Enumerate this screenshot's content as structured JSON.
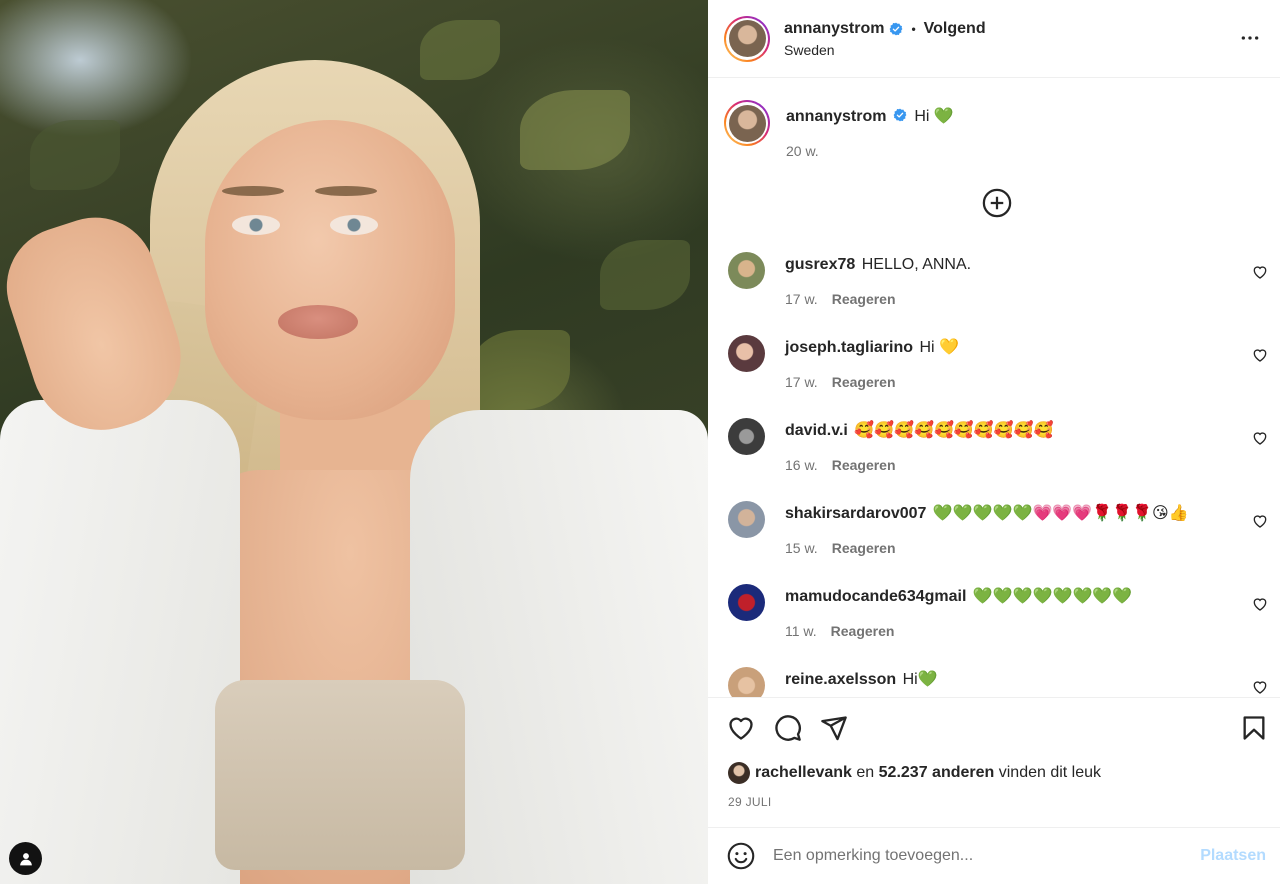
{
  "post": {
    "username": "annanystrom",
    "follow_label": "Volgend",
    "location": "Sweden",
    "separator": "•"
  },
  "caption": {
    "username": "annanystrom",
    "text": "Hi 💚",
    "time": "20 w."
  },
  "comments": [
    {
      "username": "gusrex78",
      "text": "HELLO, ANNA.",
      "time": "17 w.",
      "reply_label": "Reageren",
      "avatar_color": "#7c8a5a"
    },
    {
      "username": "joseph.tagliarino",
      "text": "Hi 💛",
      "time": "17 w.",
      "reply_label": "Reageren",
      "avatar_color": "#5a3a3e"
    },
    {
      "username": "david.v.i",
      "text": "🥰🥰🥰🥰🥰🥰🥰🥰🥰🥰",
      "time": "16 w.",
      "reply_label": "Reageren",
      "avatar_color": "#4a4a4a"
    },
    {
      "username": "shakirsardarov007",
      "text": "💚💚💚💚💚💗💗💗🌹🌹🌹😘👍",
      "time": "15 w.",
      "reply_label": "Reageren",
      "avatar_color": "#8a96a6"
    },
    {
      "username": "mamudocande634gmail",
      "text": "💚💚💚💚💚💚💚💚",
      "time": "11 w.",
      "reply_label": "Reageren",
      "avatar_color": "#1b2a7a"
    },
    {
      "username": "reine.axelsson",
      "text": "Hi💚",
      "time": "",
      "reply_label": "",
      "avatar_color": "#c9a07a"
    }
  ],
  "likes": {
    "user": "rachellevank",
    "connector": "en",
    "count": "52.237 anderen",
    "suffix": "vinden dit leuk"
  },
  "date": "29 JULI",
  "add_comment": {
    "placeholder": "Een opmerking toevoegen...",
    "post_label": "Plaatsen"
  },
  "colors": {
    "verified": "#3897f0",
    "muted": "#737373",
    "post_disabled": "#b3dbff",
    "text": "#262626"
  },
  "icons": [
    "verified-icon",
    "more-icon",
    "add-circle-icon",
    "heart-icon",
    "comment-icon",
    "share-icon",
    "bookmark-icon",
    "emoji-icon",
    "user-tag-icon"
  ]
}
